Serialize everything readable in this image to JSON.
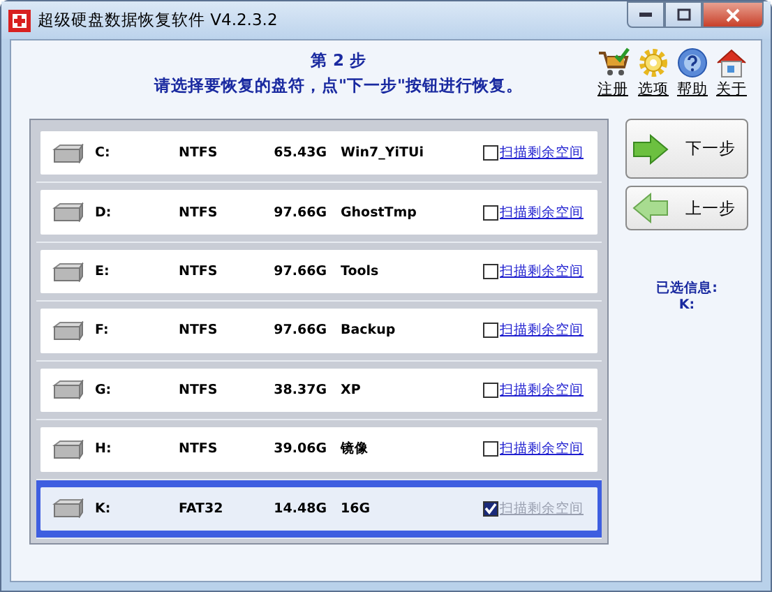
{
  "window": {
    "title": "超级硬盘数据恢复软件 V4.2.3.2"
  },
  "header": {
    "step": "第 2 步",
    "instruction": "请选择要恢复的盘符，点\"下一步\"按钮进行恢复。"
  },
  "toolbar": [
    {
      "kind": "cart",
      "label": "注册"
    },
    {
      "kind": "gear",
      "label": "选项"
    },
    {
      "kind": "help",
      "label": "帮助"
    },
    {
      "kind": "home",
      "label": "关于"
    }
  ],
  "disks": [
    {
      "letter": "C:",
      "fs": "NTFS",
      "size": "65.43G",
      "name": "Win7_YiTUi",
      "selected": false,
      "checked": false,
      "link": "扫描剩余空间"
    },
    {
      "letter": "D:",
      "fs": "NTFS",
      "size": "97.66G",
      "name": "GhostTmp",
      "selected": false,
      "checked": false,
      "link": "扫描剩余空间"
    },
    {
      "letter": "E:",
      "fs": "NTFS",
      "size": "97.66G",
      "name": "Tools",
      "selected": false,
      "checked": false,
      "link": "扫描剩余空间"
    },
    {
      "letter": "F:",
      "fs": "NTFS",
      "size": "97.66G",
      "name": "Backup",
      "selected": false,
      "checked": false,
      "link": "扫描剩余空间"
    },
    {
      "letter": "G:",
      "fs": "NTFS",
      "size": "38.37G",
      "name": "XP",
      "selected": false,
      "checked": false,
      "link": "扫描剩余空间"
    },
    {
      "letter": "H:",
      "fs": "NTFS",
      "size": "39.06G",
      "name": "镜像",
      "selected": false,
      "checked": false,
      "link": "扫描剩余空间"
    },
    {
      "letter": "K:",
      "fs": "FAT32",
      "size": "14.48G",
      "name": "16G",
      "selected": true,
      "checked": true,
      "link": "扫描剩余空间"
    }
  ],
  "buttons": [
    {
      "kind": "next",
      "label": "下一步"
    },
    {
      "kind": "prev",
      "label": "上一步"
    }
  ],
  "info": {
    "label": "已选信息:",
    "value": "K:"
  }
}
